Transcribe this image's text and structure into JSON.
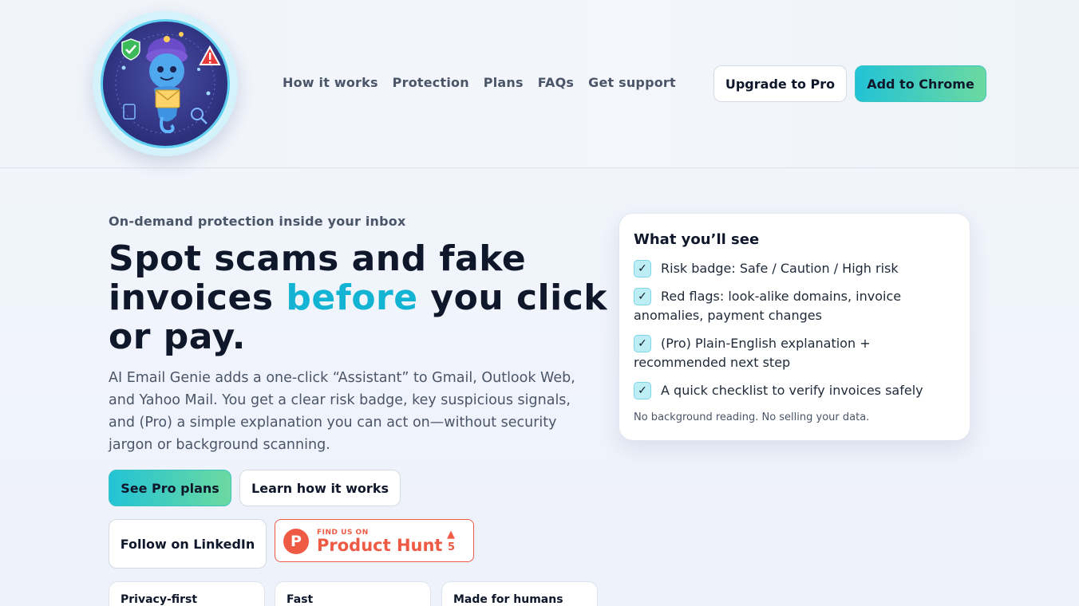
{
  "nav": {
    "items": [
      "How it works",
      "Protection",
      "Plans",
      "FAQs",
      "Get support"
    ],
    "upgrade_label": "Upgrade to Pro",
    "add_chrome_label": "Add to Chrome"
  },
  "hero": {
    "eyebrow": "On-demand protection inside your inbox",
    "headline_part1": "Spot scams and fake invoices ",
    "headline_accent": "before",
    "headline_part2": " you click or pay.",
    "lede": "AI Email Genie adds a one-click “Assistant” to Gmail, Outlook Web, and Yahoo Mail. You get a clear risk badge, key suspicious signals, and (Pro) a simple explanation you can act on—without security jargon or background scanning.",
    "primary_cta": "See Pro plans",
    "secondary_cta": "Learn how it works",
    "linkedin_label": "Follow on LinkedIn"
  },
  "product_hunt": {
    "small": "FIND US ON",
    "big": "Product Hunt",
    "logo_letter": "P",
    "count": "5"
  },
  "card": {
    "title": "What you’ll see",
    "items": [
      "Risk badge: Safe / Caution / High risk",
      "Red flags: look-alike domains, invoice anomalies, payment changes",
      "(Pro) Plain-English explanation + recommended next step",
      "A quick checklist to verify invoices safely"
    ],
    "footnote": "No background reading. No selling your data."
  },
  "features": [
    "Privacy-first",
    "Fast",
    "Made for humans"
  ],
  "colors": {
    "accent": "#12b3d3",
    "gradient_start": "#22c3d6",
    "gradient_end": "#6cd9a0",
    "product_hunt": "#ef5a45"
  },
  "icons": [
    "genie-logo",
    "shield-check-icon",
    "warning-icon",
    "check-icon",
    "product-hunt-icon",
    "upvote-triangle-icon"
  ]
}
